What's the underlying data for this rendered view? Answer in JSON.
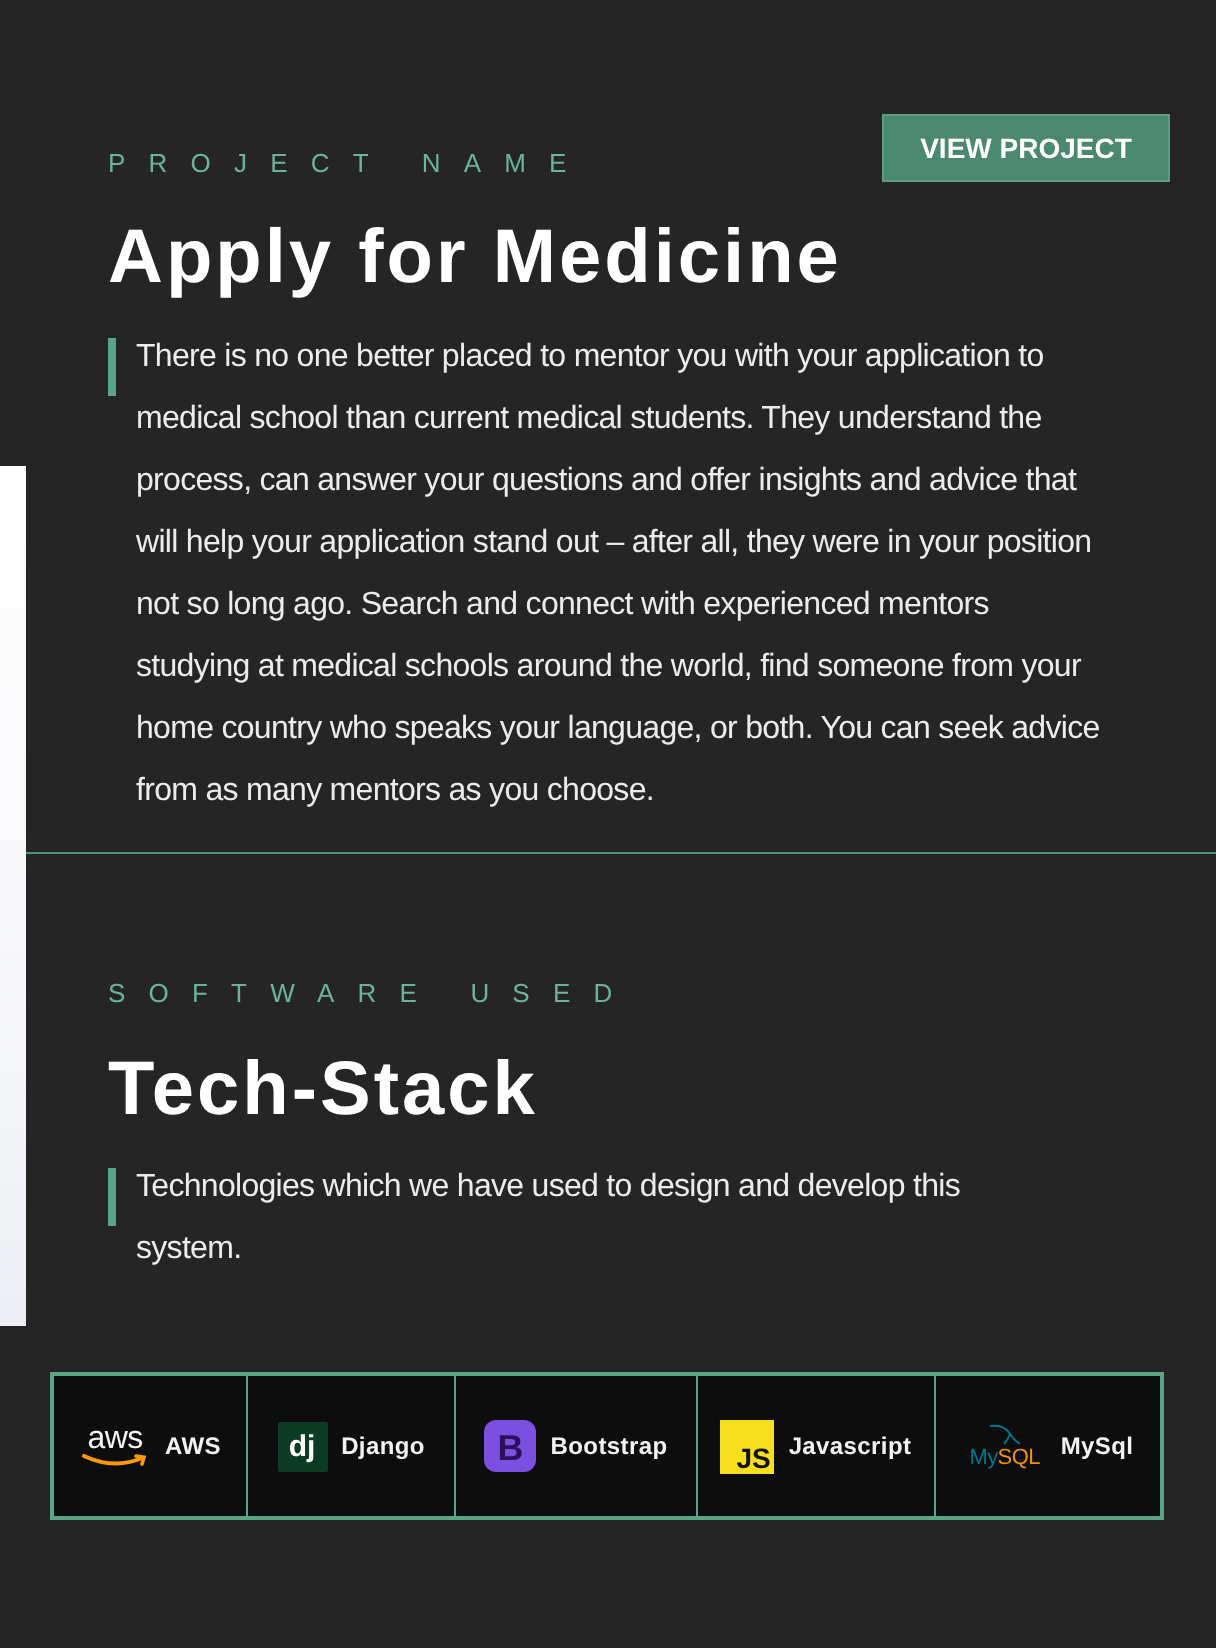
{
  "project": {
    "eyebrow": "PROJECT NAME",
    "title": "Apply for Medicine",
    "button": "VIEW PROJECT",
    "description": "There is no one better placed to mentor you with your application to medical school than current medical students. They understand the process, can answer your questions and offer insights and advice that will help your application stand out – after all, they were in your position not so long ago. Search and connect with experienced mentors studying at medical schools around the world, find someone from your home country who speaks your language, or both. You can seek advice from as many mentors as you choose."
  },
  "tech_stack": {
    "eyebrow": "SOFTWARE USED",
    "title": "Tech-Stack",
    "description": "Technologies which we have used to design and develop this system.",
    "items": [
      {
        "kind": "aws",
        "logo_parts": [
          "aws"
        ],
        "name": "AWS"
      },
      {
        "kind": "django",
        "logo_parts": [
          "dj"
        ],
        "name": "Django"
      },
      {
        "kind": "bootstrap",
        "logo_parts": [
          "B"
        ],
        "name": "Bootstrap"
      },
      {
        "kind": "javascript",
        "logo_parts": [
          "JS"
        ],
        "name": "Javascript"
      },
      {
        "kind": "mysql",
        "logo_parts": [
          "My",
          "SQL"
        ],
        "name": "MySql"
      }
    ]
  }
}
